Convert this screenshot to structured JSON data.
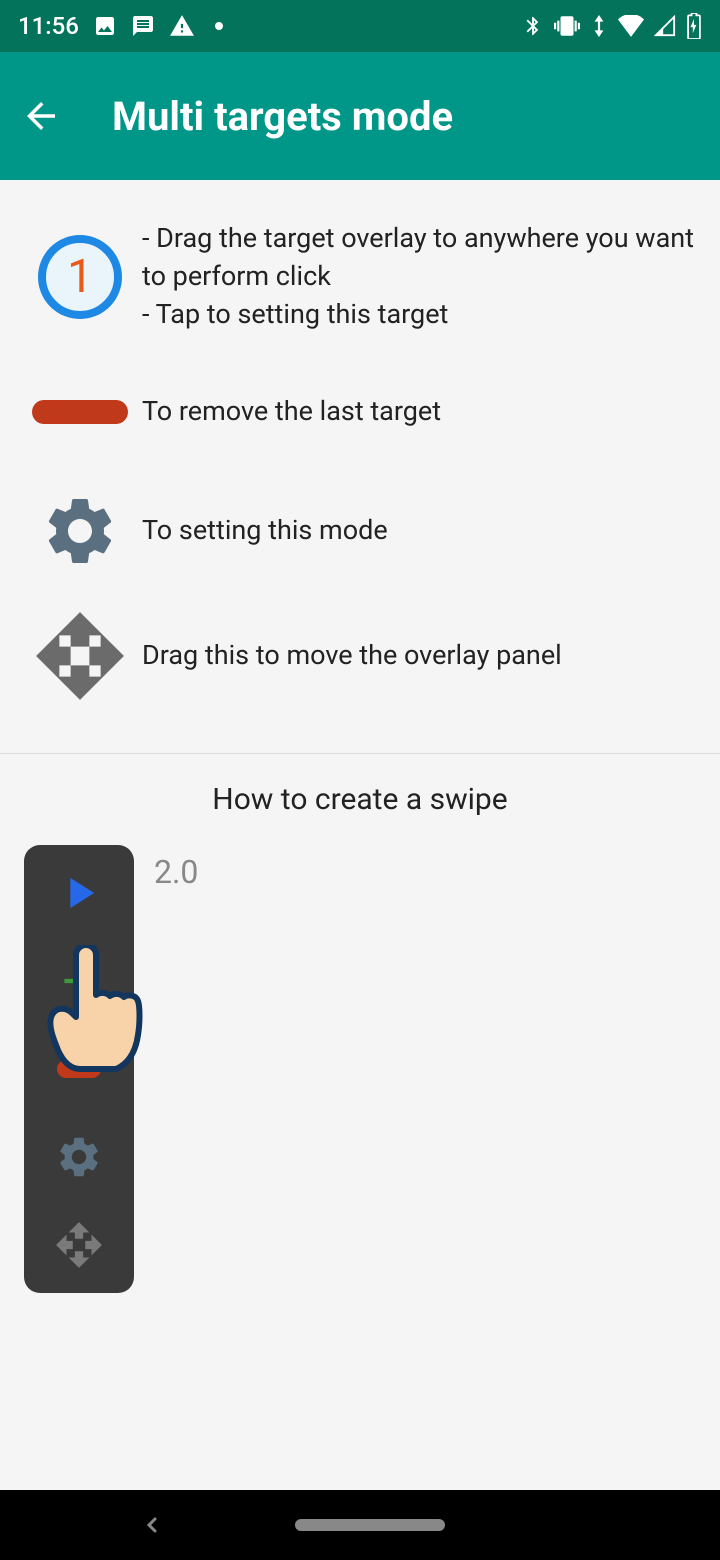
{
  "status": {
    "time": "11:56"
  },
  "appbar": {
    "title": "Multi targets mode"
  },
  "rows": {
    "target": {
      "number": "1",
      "line1": "- Drag the target overlay to anywhere you want to perform click",
      "line2": "- Tap to setting this target"
    },
    "remove": {
      "text": "To remove the last target"
    },
    "settings": {
      "text": "To setting this mode"
    },
    "move": {
      "text": "Drag this to move the overlay panel"
    }
  },
  "swipe": {
    "heading": "How to create a swipe",
    "version": "2.0"
  }
}
